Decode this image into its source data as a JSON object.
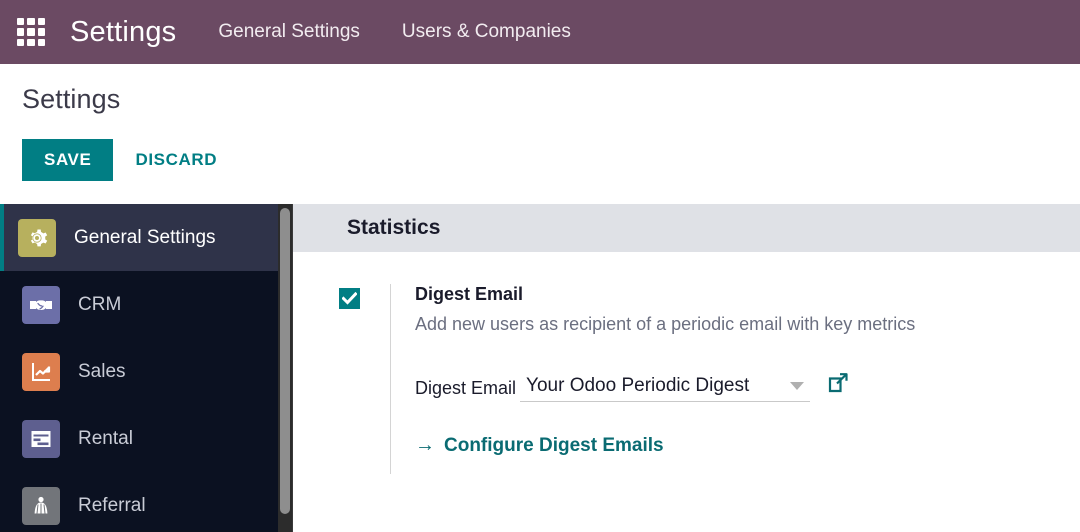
{
  "navbar": {
    "apps_icon": "apps-grid-icon",
    "brand": "Settings",
    "menu_items": [
      {
        "label": "General Settings"
      },
      {
        "label": "Users & Companies"
      }
    ],
    "background_color": "#6b4a63"
  },
  "control_panel": {
    "title": "Settings",
    "save_label": "SAVE",
    "discard_label": "DISCARD",
    "accent_color": "#017e84"
  },
  "sidebar": {
    "items": [
      {
        "label": "General Settings",
        "icon": "gear-icon",
        "icon_color": "#b7b05e",
        "active": true
      },
      {
        "label": "CRM",
        "icon": "handshake-icon",
        "icon_color": "#6c6fa8",
        "active": false
      },
      {
        "label": "Sales",
        "icon": "chart-up-icon",
        "icon_color": "#dd7e4e",
        "active": false
      },
      {
        "label": "Rental",
        "icon": "calendar-icon",
        "icon_color": "#5e5f8f",
        "active": false
      },
      {
        "label": "Referral",
        "icon": "person-icon",
        "icon_color": "#72757a",
        "active": false
      }
    ],
    "background_color": "#0b1121",
    "active_background_color": "#2f3349"
  },
  "content": {
    "section_title": "Statistics",
    "digest": {
      "checkbox_checked": true,
      "label": "Digest Email",
      "description": "Add new users as recipient of a periodic email with key metrics",
      "field_label": "Digest Email",
      "field_value": "Your Odoo Periodic Digest",
      "external_link_icon": "external-link-icon",
      "configure_arrow": "→",
      "configure_label": "Configure Digest Emails"
    }
  }
}
